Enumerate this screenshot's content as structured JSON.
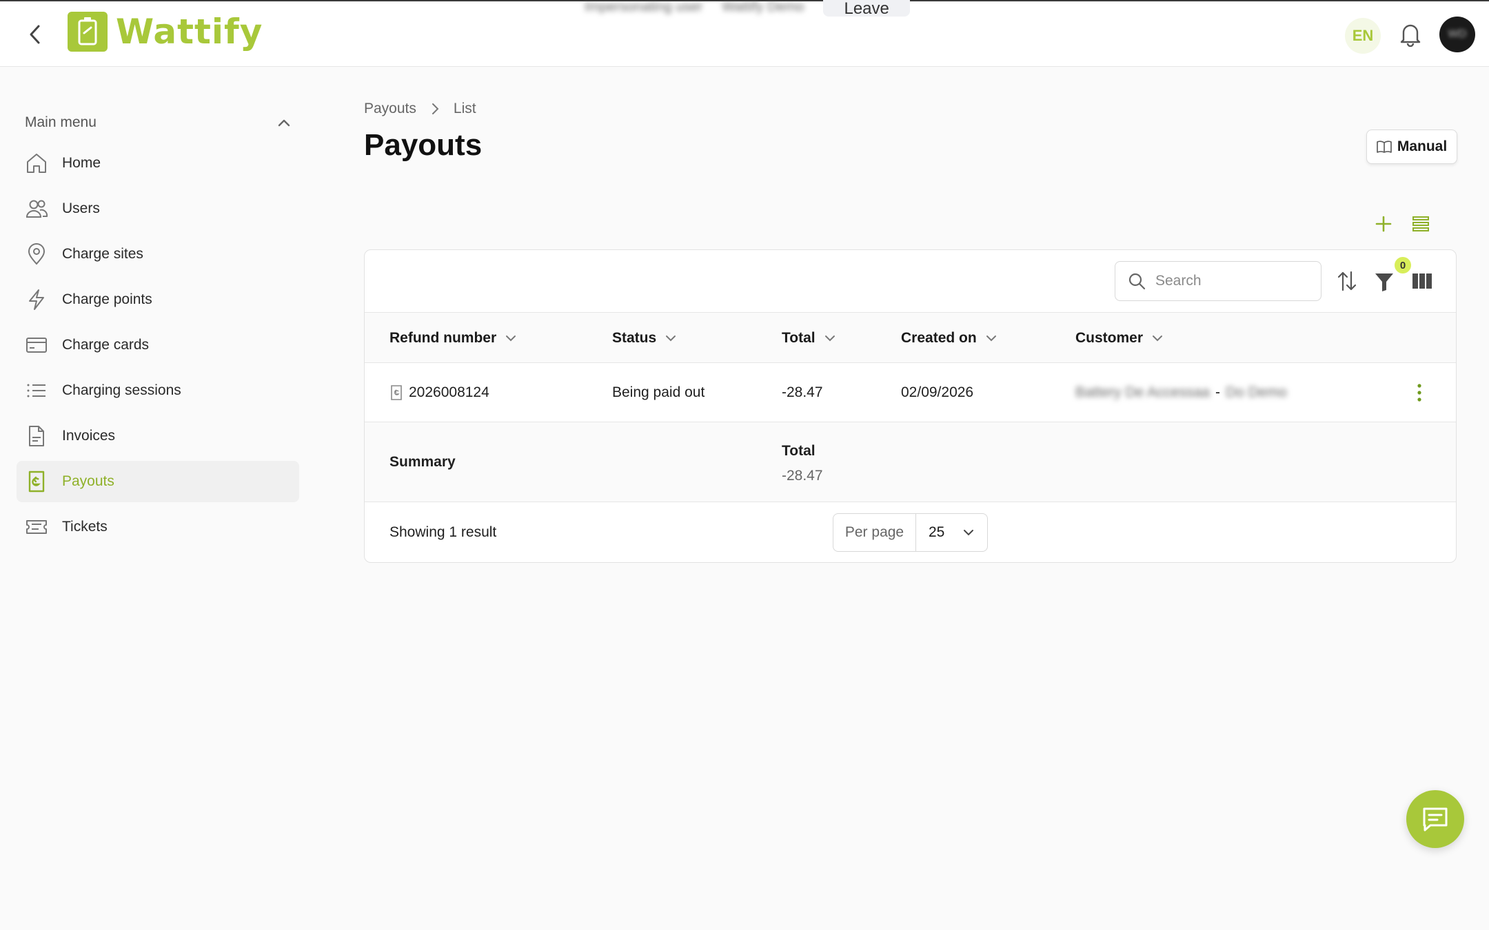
{
  "impersonation": {
    "user_text": "Impersonating user",
    "user_name": "Wattify Demo",
    "leave_label": "Leave"
  },
  "header": {
    "logo_text": "Wattify",
    "language": "EN",
    "avatar_initials": "WD"
  },
  "sidebar": {
    "menu_title": "Main menu",
    "items": [
      {
        "label": "Home",
        "icon": "home-icon"
      },
      {
        "label": "Users",
        "icon": "users-icon"
      },
      {
        "label": "Charge sites",
        "icon": "location-pin-icon"
      },
      {
        "label": "Charge points",
        "icon": "lightning-icon"
      },
      {
        "label": "Charge cards",
        "icon": "card-icon"
      },
      {
        "label": "Charging sessions",
        "icon": "list-icon"
      },
      {
        "label": "Invoices",
        "icon": "document-icon"
      },
      {
        "label": "Payouts",
        "icon": "payout-icon",
        "active": true
      },
      {
        "label": "Tickets",
        "icon": "ticket-icon"
      }
    ]
  },
  "breadcrumb": {
    "parent": "Payouts",
    "current": "List"
  },
  "page": {
    "title": "Payouts",
    "manual_label": "Manual"
  },
  "toolbar": {
    "search_placeholder": "Search",
    "filter_count": "0"
  },
  "table": {
    "columns": [
      "Refund number",
      "Status",
      "Total",
      "Created on",
      "Customer"
    ],
    "rows": [
      {
        "refund_number": "2026008124",
        "status": "Being paid out",
        "total": "-28.47",
        "created_on": "02/09/2026",
        "customer_name": "Battery De Accessaa",
        "customer_separator": "-",
        "customer_org": "Do Demo"
      }
    ],
    "summary": {
      "label": "Summary",
      "total_label": "Total",
      "total_value": "-28.47"
    }
  },
  "pagination": {
    "showing_text": "Showing 1 result",
    "per_page_label": "Per page",
    "per_page_value": "25"
  },
  "colors": {
    "brand": "#a8c83a",
    "badge": "#d8ee5a"
  }
}
